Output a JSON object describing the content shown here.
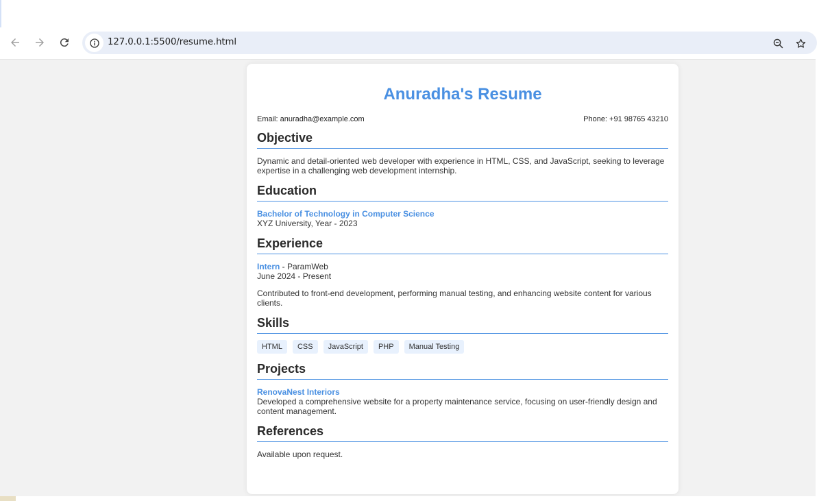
{
  "browser": {
    "url": "127.0.0.1:5500/resume.html",
    "icons": {
      "back": "arrow-left-icon",
      "forward": "arrow-right-icon",
      "reload": "reload-icon",
      "site_info": "info-icon",
      "zoom": "zoom-out-icon",
      "bookmark": "star-icon"
    }
  },
  "resume": {
    "title": "Anuradha's Resume",
    "email": "Email: anuradha@example.com",
    "phone": "Phone: +91 98765 43210",
    "accent_color": "#4a90e2",
    "objective": {
      "heading": "Objective",
      "text": "Dynamic and detail-oriented web developer with experience in HTML, CSS, and JavaScript, seeking to leverage expertise in a challenging web development internship."
    },
    "education": {
      "heading": "Education",
      "degree": "Bachelor of Technology in Computer Science",
      "institution": "XYZ University, Year - 2023"
    },
    "experience": {
      "heading": "Experience",
      "role": "Intern",
      "company": " - ParamWeb",
      "dates": "June 2024 - Present",
      "description": "Contributed to front-end development, performing manual testing, and enhancing website content for various clients."
    },
    "skills": {
      "heading": "Skills",
      "items": [
        "HTML",
        "CSS",
        "JavaScript",
        "PHP",
        "Manual Testing"
      ]
    },
    "projects": {
      "heading": "Projects",
      "name": "RenovaNest Interiors",
      "description": "Developed a comprehensive website for a property maintenance service, focusing on user-friendly design and content management."
    },
    "references": {
      "heading": "References",
      "text": "Available upon request."
    }
  }
}
